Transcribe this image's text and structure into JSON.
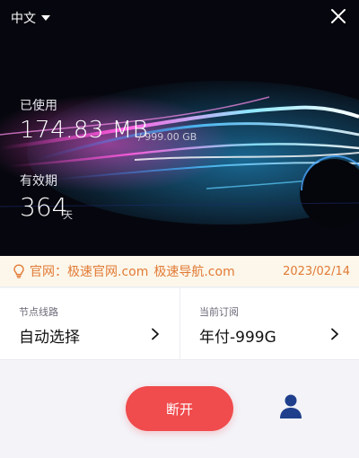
{
  "header": {
    "language": "中文",
    "close_icon": "close-icon"
  },
  "usage": {
    "used_label": "已使用",
    "used_value": "174.83 MB",
    "total": "/ 999.00 GB",
    "valid_label": "有效期",
    "valid_value": "364",
    "valid_unit": "天"
  },
  "notice": {
    "icon": "lightbulb-icon",
    "prefix": "官网：",
    "link1": "极速官网.com",
    "link2": "极速导航.com",
    "date": "2023/02/14",
    "color": "#e27a36"
  },
  "cards": {
    "route_title": "节点线路",
    "route_value": "自动选择",
    "plan_title": "当前订阅",
    "plan_value": "年付-999G"
  },
  "actions": {
    "disconnect_label": "断开",
    "disconnect_color": "#f04b4d",
    "user_icon": "user-icon",
    "user_color": "#1f3f8c"
  }
}
